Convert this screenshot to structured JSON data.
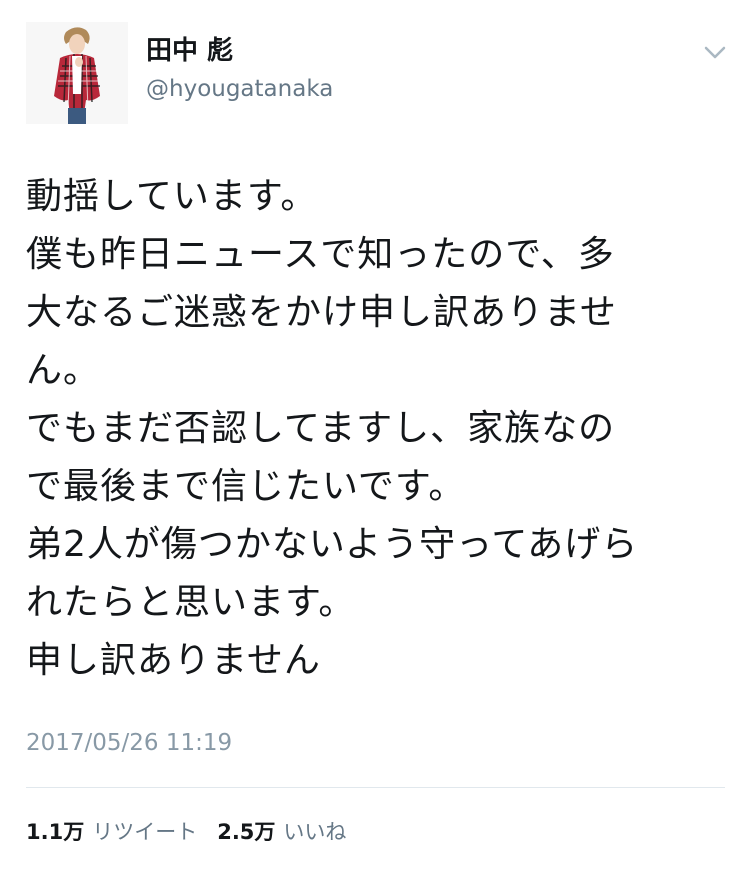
{
  "user": {
    "display_name": "田中 彪",
    "handle": "@hyougatanaka",
    "avatar_icon": "profile-photo"
  },
  "menu": {
    "icon": "chevron-down-icon"
  },
  "tweet": {
    "lines": [
      "動揺しています。",
      "僕も昨日ニュースで知ったので、多",
      "大なるご迷惑をかけ申し訳ありませ",
      "ん。",
      "でもまだ否認してますし、家族なの",
      "で最後まで信じたいです。",
      "弟2人が傷つかないよう守ってあげら",
      "れたらと思います。",
      "申し訳ありません"
    ],
    "timestamp": "2017/05/26 11:19"
  },
  "stats": {
    "retweets_count": "1.1万",
    "retweets_label": "リツイート",
    "likes_count": "2.5万",
    "likes_label": "いいね"
  },
  "colors": {
    "text": "#14171a",
    "secondary": "#657786",
    "timestamp": "#8899a6",
    "divider": "#e1e8ed"
  }
}
